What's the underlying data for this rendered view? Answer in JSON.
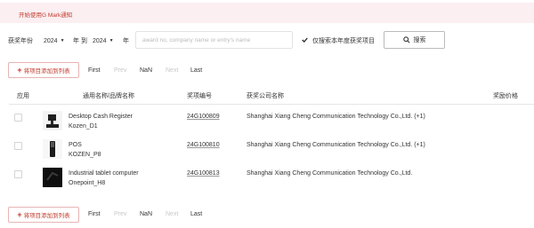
{
  "notice": {
    "text": "开始使用G Mark通知"
  },
  "filter": {
    "year_label": "获奖年份",
    "from_year": "2024",
    "to_word": "年 到",
    "to_year": "2024",
    "year_suffix": "年",
    "search_placeholder": "award no, company name or entry's name",
    "only_current_label": "仅搜索本年度获奖项目",
    "only_current_checked": true,
    "search_button": "搜索"
  },
  "toolbar": {
    "add_to_list": "将项目添加到列表"
  },
  "pagination": {
    "first": "First",
    "prev": "Prev",
    "current": "NaN",
    "next": "Next",
    "last": "Last"
  },
  "table": {
    "headers": {
      "apply": "应用",
      "name": "通用名称/品牌名称",
      "award_no": "奖项编号",
      "company": "获奖公司名称",
      "price": "奖励价格"
    },
    "rows": [
      {
        "name_line1": "Desktop Cash Register",
        "name_line2": "Kozen_D1",
        "award_no": "24G100809",
        "company": "Shanghai Xiang Cheng Communication Technology Co.,Ltd. (+1)"
      },
      {
        "name_line1": "POS",
        "name_line2": "KOZEN_P8",
        "award_no": "24G100810",
        "company": "Shanghai Xiang Cheng Communication Technology Co.,Ltd. (+1)"
      },
      {
        "name_line1": "Industrial tablet computer",
        "name_line2": "Onepoint_H8",
        "award_no": "24G100813",
        "company": "Shanghai Xiang Cheng Communication Technology Co.,Ltd."
      }
    ]
  },
  "colors": {
    "accent": "#c0392b",
    "notice_bg": "#fbeff1"
  },
  "icons": {
    "search": "search-icon",
    "check": "checkmark-icon",
    "plus": "plus-icon",
    "caret": "caret-down-icon"
  }
}
